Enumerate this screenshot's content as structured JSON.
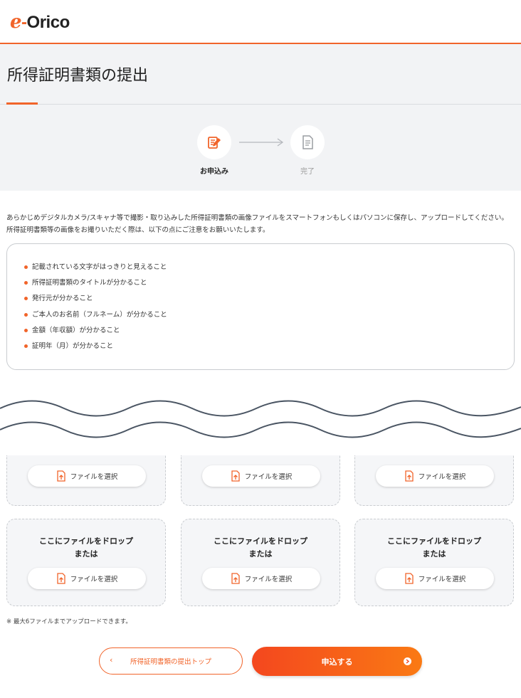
{
  "header": {
    "logo_e": "e",
    "logo_dash": "-",
    "logo_text": "Orico"
  },
  "page": {
    "title": "所得証明書類の提出"
  },
  "steps": [
    {
      "label": "お申込み",
      "icon": "edit-document-icon",
      "active": true
    },
    {
      "label": "完了",
      "icon": "document-icon",
      "active": false
    }
  ],
  "intro": {
    "line1": "あらかじめデジタルカメラ/スキャナ等で撮影・取り込みした所得証明書類の画像ファイルをスマートフォンもしくはパソコンに保存し、アップロードしてください。",
    "line2": "所得証明書類等の画像をお撮りいただく際は、以下の点にご注意をお願いいたします。"
  },
  "notes": {
    "items": [
      "記載されている文字がはっきりと見えること",
      "所得証明書類のタイトルが分かること",
      "発行元が分かること",
      "ご本人のお名前（フルネーム）が分かること",
      "金額（年収額）が分かること",
      "証明年（月）が分かること"
    ]
  },
  "upload": {
    "drop_line1": "ここにファイルをドロップ",
    "drop_line2": "または",
    "select_label": "ファイルを選択",
    "max_note": "※ 最大6ファイルまでアップロードできます。"
  },
  "actions": {
    "back_label": "所得証明書類の提出トップ",
    "back_chevron": "‹",
    "apply_label": "申込する"
  },
  "colors": {
    "accent": "#f1642a",
    "gradient_start": "#f4471e",
    "gradient_end": "#fa7a14"
  }
}
